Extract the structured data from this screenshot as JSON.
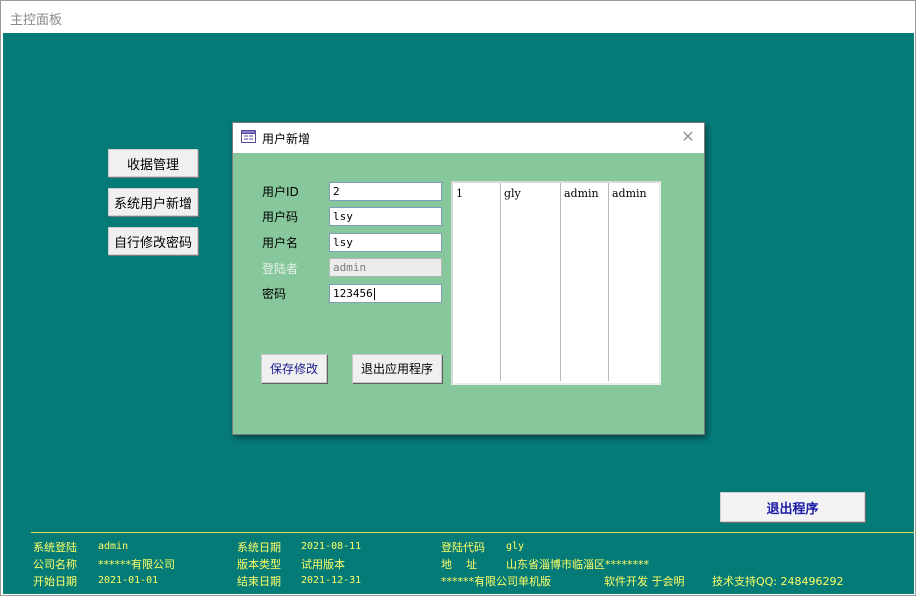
{
  "window": {
    "title": "主控面板"
  },
  "sidebar": {
    "buttons": [
      "收据管理",
      "系统用户新增",
      "自行修改密码"
    ]
  },
  "exit_button": "退出程序",
  "dialog": {
    "title": "用户新增",
    "fields": {
      "user_id": {
        "label": "用户ID",
        "value": "2"
      },
      "user_code": {
        "label": "用户码",
        "value": "lsy"
      },
      "user_name": {
        "label": "用户名",
        "value": "lsy"
      },
      "login": {
        "label": "登陆者",
        "value": "admin"
      },
      "password": {
        "label": "密码",
        "value": "123456"
      }
    },
    "save_button": "保存修改",
    "quit_button": "退出应用程序",
    "list_row": [
      "1",
      "gly",
      "admin",
      "admin"
    ]
  },
  "status_bar": {
    "login_label": "系统登陆",
    "login_value": "admin",
    "company_label": "公司名称",
    "company_value": "******有限公司",
    "start_label": "开始日期",
    "start_value": "2021-01-01",
    "sysdate_label": "系统日期",
    "sysdate_value": "2021-08-11",
    "version_label": "版本类型",
    "version_value": "试用版本",
    "end_label": "结束日期",
    "end_value": "2021-12-31",
    "code_label": "登陆代码",
    "code_value": "gly",
    "address_label": "地    址",
    "address_value": "山东省淄博市临淄区********",
    "edition": "******有限公司单机版",
    "developer": "软件开发 于会明",
    "support": "技术支持QQ: 248496292"
  },
  "colors": {
    "background": "#057b78",
    "dialog": "#86c89c",
    "status_text": "#ffff66"
  }
}
